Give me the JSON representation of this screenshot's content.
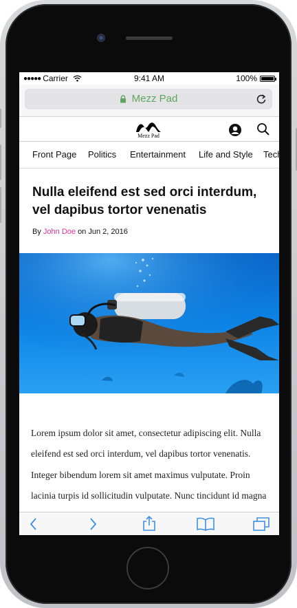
{
  "status": {
    "carrier": "Carrier",
    "time": "9:41 AM",
    "battery": "100%"
  },
  "browser": {
    "url": "Mezz Pad"
  },
  "site": {
    "logo_text": "Mezz Pad"
  },
  "nav": {
    "items": [
      "Front Page",
      "Politics",
      "Entertainment",
      "Life and Style",
      "Tech"
    ]
  },
  "article": {
    "title": "Nulla eleifend est sed orci interdum, vel dapibus tortor venenatis",
    "by": "By",
    "author": "John Doe",
    "on": "on",
    "date": "Jun 2, 2016",
    "body": "Lorem ipsum dolor sit amet, consectetur adipiscing elit. Nulla eleifend est sed orci interdum, vel dapibus tortor venenatis. Integer bibendum lorem sit amet maximus vulputate. Proin lacinia turpis id sollicitudin vulputate. Nunc tincidunt id magna a tempus. Sed quis dolor lorem. Donec sollicitudin."
  },
  "colors": {
    "accent": "#e0339a",
    "url_green": "#5fa55f",
    "toolbar_blue": "#3d8fe6"
  },
  "icons": [
    "lock-icon",
    "reload-icon",
    "user-icon",
    "search-icon",
    "back-icon",
    "forward-icon",
    "share-icon",
    "bookmarks-icon",
    "tabs-icon",
    "wifi-icon"
  ]
}
